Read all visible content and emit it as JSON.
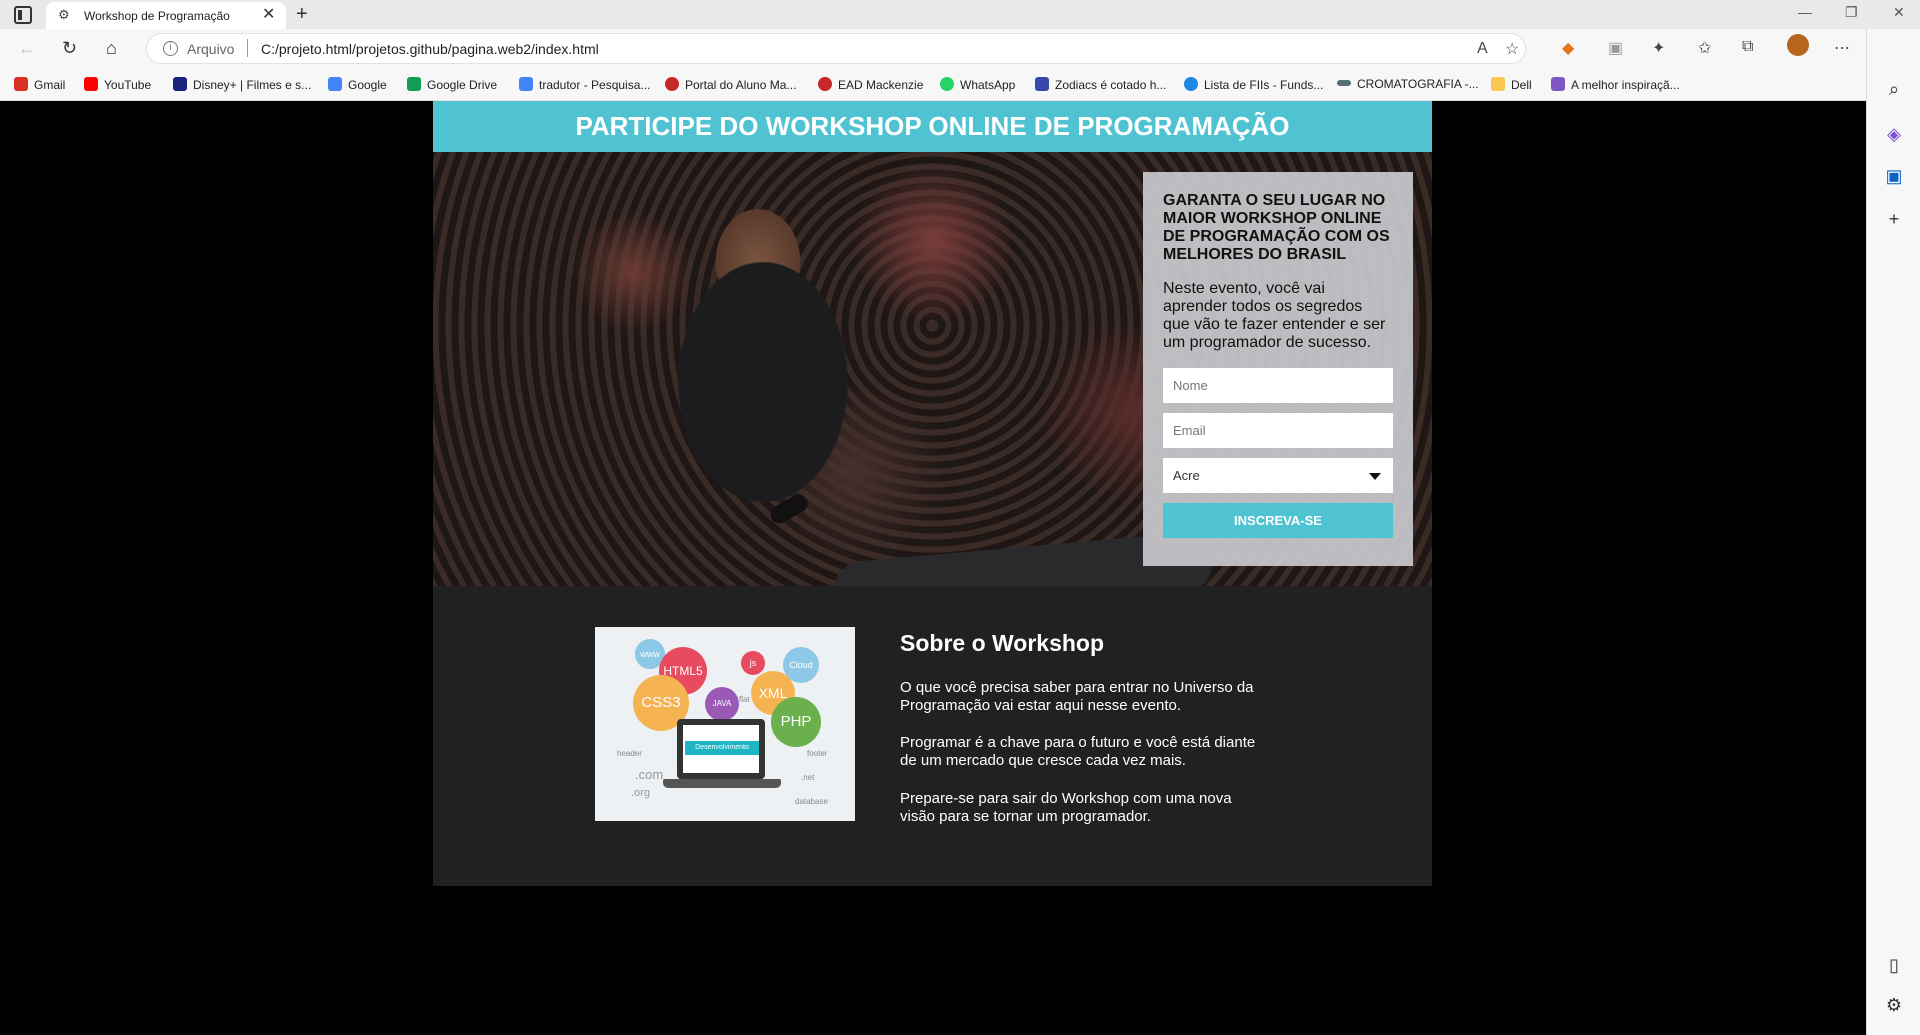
{
  "browser": {
    "tab_title": "Workshop de Programação",
    "address_scheme": "Arquivo",
    "url": "C:/projeto.html/projetos.github/pagina.web2/index.html",
    "bookmarks": [
      {
        "label": "Gmail",
        "color": "#d93025"
      },
      {
        "label": "YouTube",
        "color": "#ff0000"
      },
      {
        "label": "Disney+ | Filmes e s...",
        "color": "#1a237e"
      },
      {
        "label": "Google",
        "color": "#4285f4"
      },
      {
        "label": "Google Drive",
        "color": "#0f9d58"
      },
      {
        "label": "tradutor - Pesquisa...",
        "color": "#4285f4"
      },
      {
        "label": "Portal do Aluno Ma...",
        "color": "#c62828"
      },
      {
        "label": "EAD Mackenzie",
        "color": "#c62828"
      },
      {
        "label": "WhatsApp",
        "color": "#25d366"
      },
      {
        "label": "Zodiacs é cotado h...",
        "color": "#3949ab"
      },
      {
        "label": "Lista de FIIs - Funds...",
        "color": "#1e88e5"
      },
      {
        "label": "CROMATOGRAFIA -...",
        "color": "#546e7a"
      },
      {
        "label": "Dell",
        "color": "#f9c74f"
      },
      {
        "label": "A melhor inspiraçã...",
        "color": "#7e57c2"
      }
    ]
  },
  "page": {
    "banner": "PARTICIPE DO WORKSHOP ONLINE DE PROGRAMAÇÃO",
    "form": {
      "heading": "GARANTA O SEU LUGAR NO MAIOR WORKSHOP ONLINE DE PROGRAMAÇÃO COM OS MELHORES DO BRASIL",
      "description": "Neste evento, você vai aprender todos os segredos que vão te fazer entender e ser um programador de sucesso.",
      "name_placeholder": "Nome",
      "email_placeholder": "Email",
      "state_selected": "Acre",
      "submit_label": "INSCREVA-SE"
    },
    "about": {
      "title": "Sobre o Workshop",
      "paragraphs": [
        "O que você precisa saber para entrar no Universo da Programação vai estar aqui nesse evento.",
        "Programar é a chave para o futuro e você está diante de um mercado que cresce cada vez mais.",
        "Prepare-se para sair do Workshop com uma nova visão para se tornar um programador."
      ],
      "image": {
        "bubbles": [
          "www",
          "HTML5",
          "js",
          "Cloud",
          "CSS3",
          "JAVA",
          "XML",
          "PHP"
        ],
        "screen_label": "Desenvolvimento",
        "words": [
          "flat",
          "header",
          "footer",
          ".com",
          ".org",
          ".net",
          "database"
        ]
      }
    },
    "colors": {
      "accent": "#4fc3d1",
      "section_bg": "#212121",
      "form_bg": "#c8c8cc"
    }
  }
}
